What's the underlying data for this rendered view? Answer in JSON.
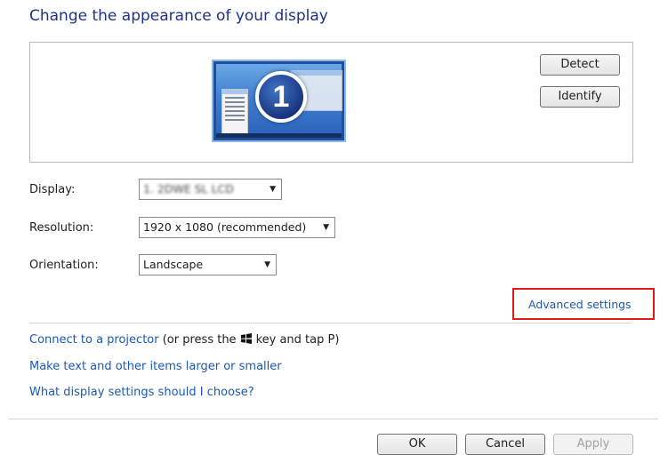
{
  "title": "Change the appearance of your display",
  "preview": {
    "monitor_number": "1"
  },
  "buttons": {
    "detect": "Detect",
    "identify": "Identify",
    "ok": "OK",
    "cancel": "Cancel",
    "apply": "Apply"
  },
  "form": {
    "display": {
      "label": "Display:",
      "value": "1. 2DWE SL LCD"
    },
    "resolution": {
      "label": "Resolution:",
      "value": "1920 x 1080 (recommended)"
    },
    "orientation": {
      "label": "Orientation:",
      "value": "Landscape"
    }
  },
  "links": {
    "advanced": "Advanced settings",
    "connect_projector": "Connect to a projector",
    "connect_suffix_a": "(or press the",
    "connect_suffix_b": "key and tap P)",
    "text_larger": "Make text and other items larger or smaller",
    "which_settings": "What display settings should I choose?"
  },
  "colors": {
    "link": "#1a59b7",
    "title": "#1e3287",
    "highlight": "#e21a1a"
  },
  "icons": [
    "monitor-icon",
    "windows-logo-icon",
    "dropdown-arrow-icon"
  ]
}
